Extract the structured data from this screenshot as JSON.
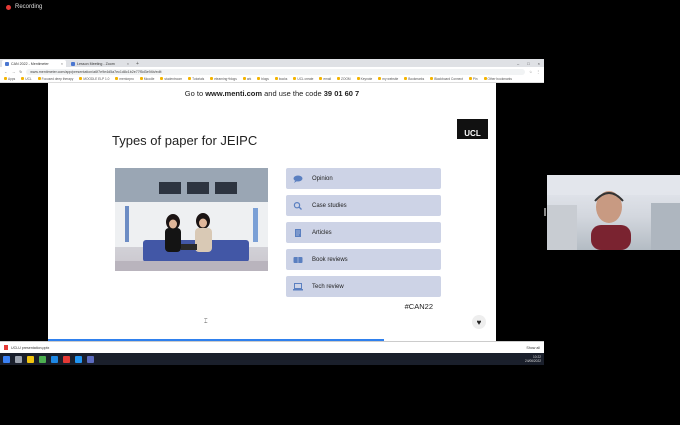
{
  "recording": {
    "label": "Recording"
  },
  "browser": {
    "tabs": [
      {
        "label": "CAN 2022 - Mentimeter",
        "active": true
      },
      {
        "label": "Lesson Meeting - Zoom",
        "active": false
      }
    ],
    "new_tab_icon": "plus-icon",
    "address_url": "www.mentimeter.com/app/presentation/a6f7e9e4d5a7ec1d8c1b2e77f5d3e94b/edit",
    "bookmarks": [
      "Apps",
      "UCL",
      "Focused deep therapy",
      "MOODLE ELP 1.0",
      "mentorpro",
      "Moodle",
      "studentroom",
      "Tutorials",
      "elearning+blogs",
      "ark",
      "blogs",
      "books",
      "UCL create",
      "email",
      "ZOOM",
      "Keynote",
      "my website",
      "Bookmarks",
      "Blackboard Connect",
      "Pin",
      "Other bookmarks"
    ]
  },
  "slide": {
    "menti_prefix": "Go to ",
    "menti_url": "www.menti.com",
    "menti_middle": " and use the code ",
    "menti_code": "39 01 60 7",
    "title": "Types of paper for JEIPC",
    "logo_text": "UCL",
    "types": [
      {
        "label": "Opinion",
        "icon": "speech-bubble-icon"
      },
      {
        "label": "Case studies",
        "icon": "magnifier-icon"
      },
      {
        "label": "Articles",
        "icon": "document-icon"
      },
      {
        "label": "Book reviews",
        "icon": "book-icon"
      },
      {
        "label": "Tech review",
        "icon": "laptop-icon"
      }
    ],
    "hashtag": "#CAN22",
    "heart_icon": "heart-icon"
  },
  "download_bar": {
    "file": "UCLU presentation.pptx",
    "show_all": "Show all"
  },
  "taskbar": {
    "time": "10:22",
    "date": "24/06/2022"
  },
  "colors": {
    "accent": "#2f80ed",
    "type_bg": "#cdd3e6",
    "recording": "#e53935"
  }
}
